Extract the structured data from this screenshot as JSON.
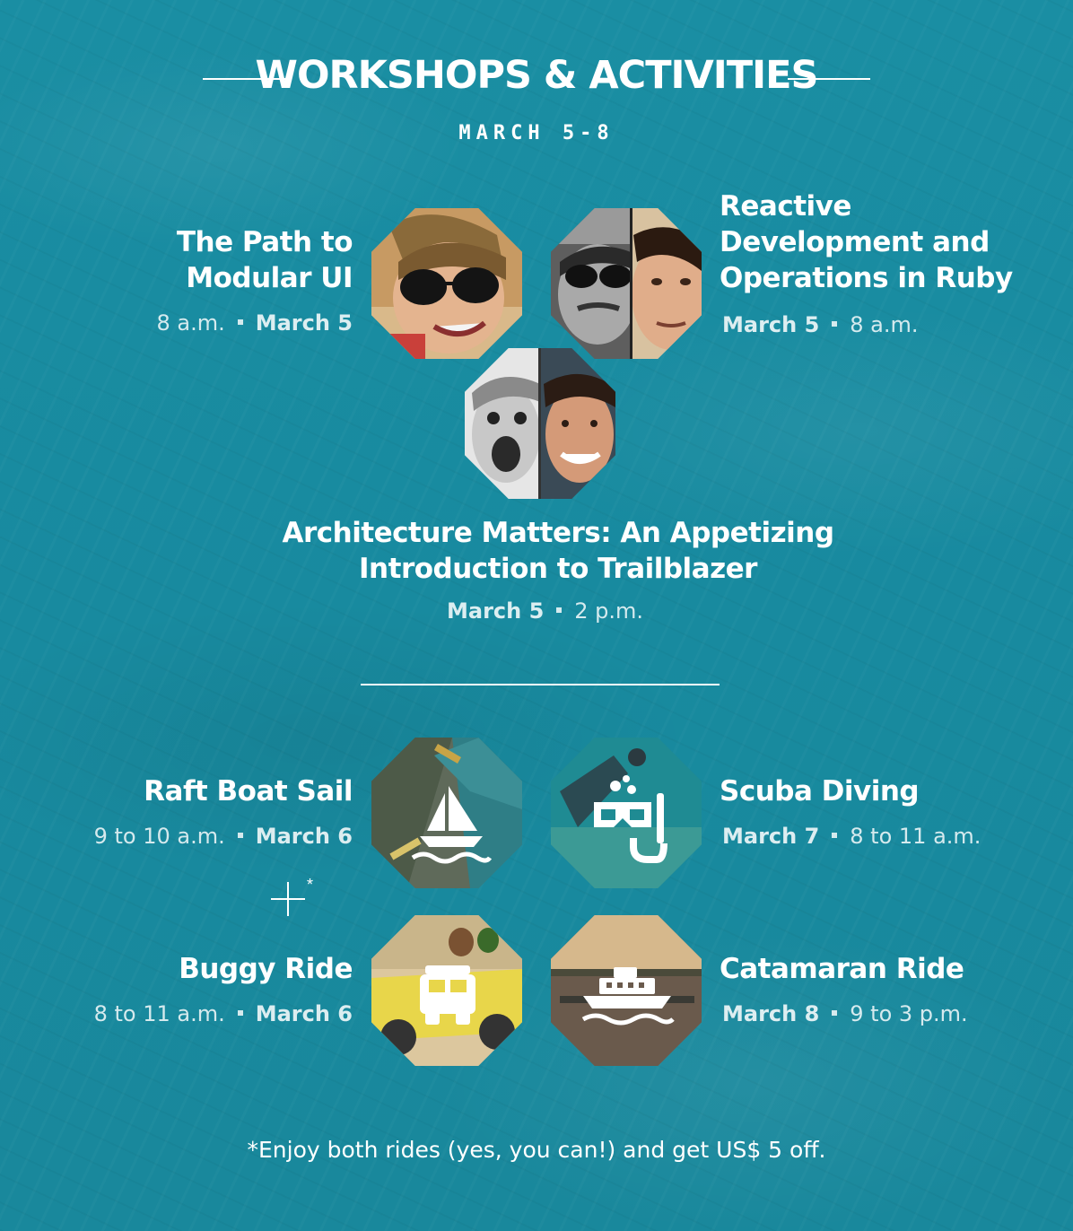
{
  "header": {
    "title": "WORKSHOPS & ACTIVITIES",
    "subtitle": "MARCH 5-8"
  },
  "workshops": [
    {
      "title_lines": [
        "The Path to",
        "Modular UI"
      ],
      "time": "8 a.m.",
      "date": "March 5"
    },
    {
      "title_lines": [
        "Reactive",
        "Development and",
        "Operations in Ruby"
      ],
      "date": "March 5",
      "time": "8 a.m."
    },
    {
      "title_lines": [
        "Architecture Matters: An Appetizing",
        "Introduction to Trailblazer"
      ],
      "date": "March 5",
      "time": "2 p.m."
    }
  ],
  "activities": [
    {
      "title": "Raft Boat Sail",
      "time": "9 to 10 a.m.",
      "date": "March 6",
      "icon": "sailboat-icon"
    },
    {
      "title": "Scuba Diving",
      "date": "March 7",
      "time": "8 to 11 a.m.",
      "icon": "scuba-mask-icon"
    },
    {
      "title": "Buggy Ride",
      "time": "8 to 11 a.m.",
      "date": "March 6",
      "icon": "buggy-icon"
    },
    {
      "title": "Catamaran Ride",
      "date": "March 8",
      "time": "9 to 3 p.m.",
      "icon": "catamaran-icon"
    }
  ],
  "combo": {
    "symbol": "+",
    "star": "*"
  },
  "footnote": "*Enjoy both rides (yes, you can!) and get US$ 5 off.",
  "colors": {
    "background": "#1a8ea3",
    "text": "#ffffff"
  }
}
